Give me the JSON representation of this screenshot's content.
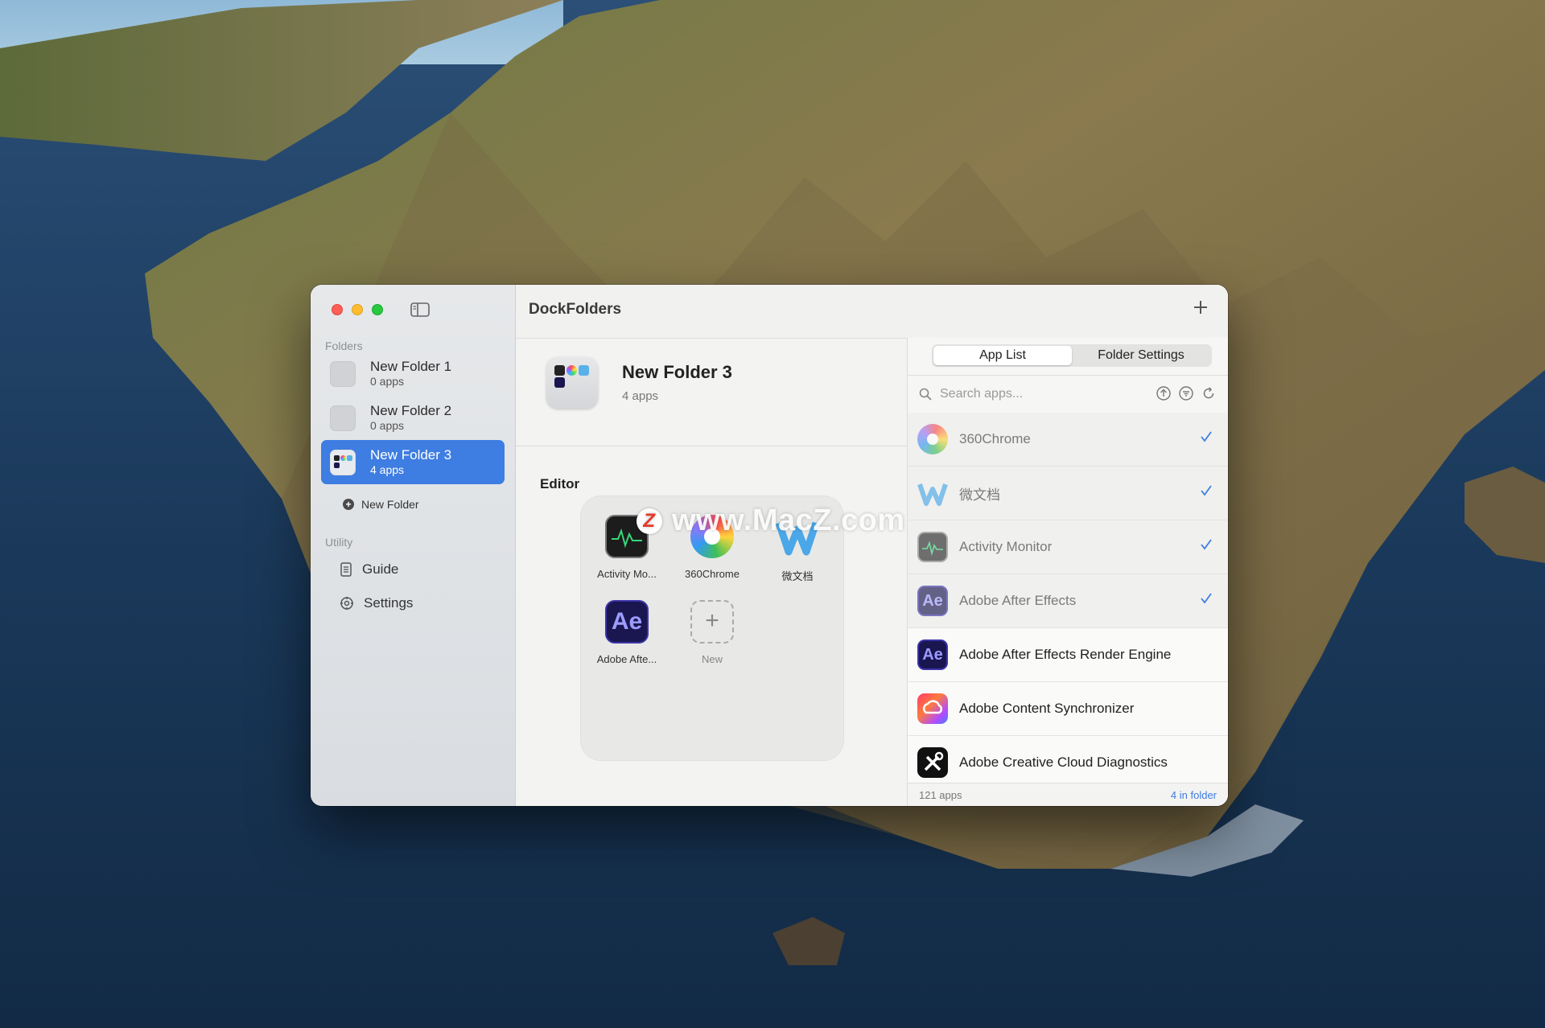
{
  "window": {
    "title": "DockFolders"
  },
  "sidebar": {
    "folders_label": "Folders",
    "folders": [
      {
        "name": "New Folder 1",
        "count": "0 apps",
        "selected": false
      },
      {
        "name": "New Folder 2",
        "count": "0 apps",
        "selected": false
      },
      {
        "name": "New Folder 3",
        "count": "4 apps",
        "selected": true
      }
    ],
    "new_folder_label": "New Folder",
    "utility_label": "Utility",
    "utility_items": [
      {
        "label": "Guide",
        "icon": "document-icon"
      },
      {
        "label": "Settings",
        "icon": "gear-icon"
      }
    ]
  },
  "folder_header": {
    "title": "New Folder 3",
    "subtitle": "4 apps"
  },
  "editor": {
    "label": "Editor",
    "apps": [
      {
        "label": "Activity Mo...",
        "icon": "activity-monitor-icon"
      },
      {
        "label": "360Chrome",
        "icon": "360chrome-icon"
      },
      {
        "label": "微文档",
        "icon": "wei-wendang-icon"
      },
      {
        "label": "Adobe Afte...",
        "icon": "adobe-after-effects-icon"
      }
    ],
    "new_label": "New"
  },
  "watermark": {
    "text": "www.MacZ.com",
    "logo_letter": "Z"
  },
  "tabs": [
    {
      "label": "App List",
      "active": true
    },
    {
      "label": "Folder Settings",
      "active": false
    }
  ],
  "search": {
    "placeholder": "Search apps...",
    "value": ""
  },
  "app_list": [
    {
      "name": "360Chrome",
      "icon": "360chrome-icon",
      "in_folder": true
    },
    {
      "name": "微文档",
      "icon": "wei-wendang-icon",
      "in_folder": true
    },
    {
      "name": "Activity Monitor",
      "icon": "activity-monitor-icon",
      "in_folder": true
    },
    {
      "name": "Adobe After Effects",
      "icon": "adobe-after-effects-icon",
      "in_folder": true
    },
    {
      "name": "Adobe After Effects Render Engine",
      "icon": "adobe-after-effects-icon",
      "in_folder": false
    },
    {
      "name": "Adobe Content Synchronizer",
      "icon": "adobe-creative-cloud-icon",
      "in_folder": false
    },
    {
      "name": "Adobe Creative Cloud Diagnostics",
      "icon": "diagnostics-tools-icon",
      "in_folder": false
    }
  ],
  "status": {
    "total": "121 apps",
    "in_folder": "4 in folder"
  },
  "colors": {
    "accent": "#3e7de1",
    "ae_bg": "#1a1650",
    "ae_text": "#9c9cff"
  },
  "icons_text": {
    "ae": "Ae"
  }
}
